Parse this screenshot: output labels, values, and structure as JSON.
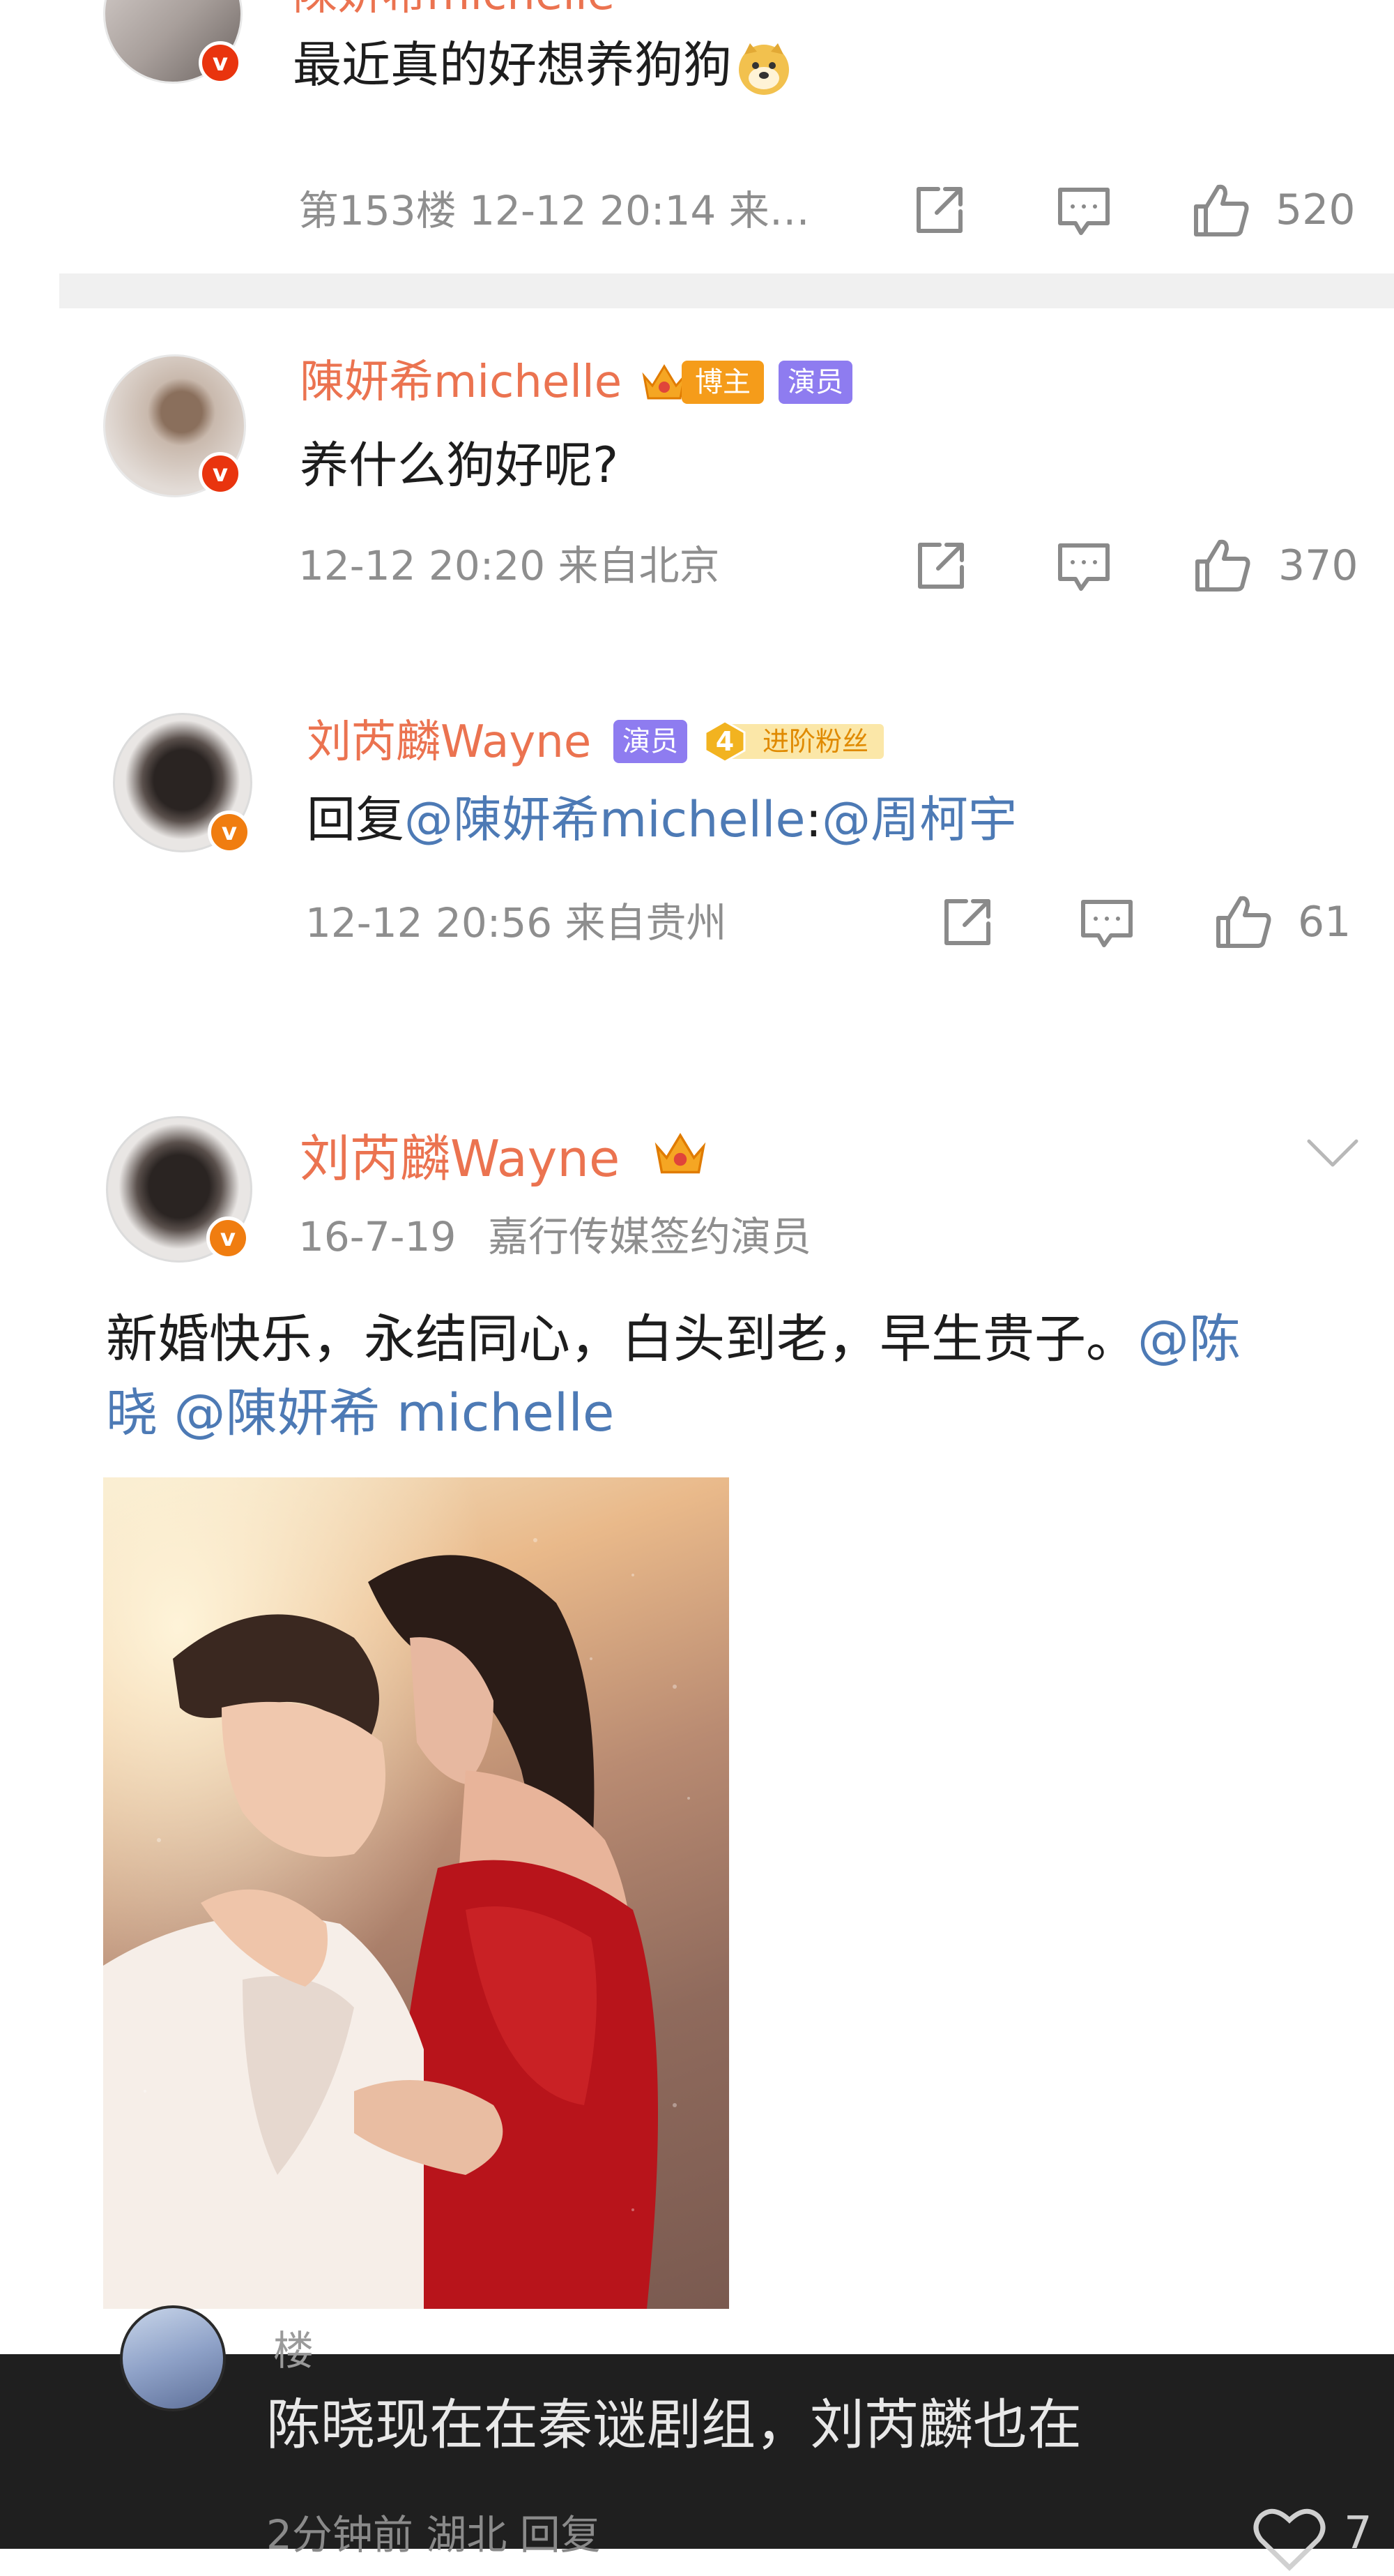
{
  "comments": [
    {
      "id": "c1",
      "text": "最近真的好想养狗狗",
      "emoji": "doge-emoji",
      "meta": "第153楼 12-12 20:14 来…",
      "likes": "520"
    },
    {
      "id": "c2",
      "username": "陳妍希michelle",
      "badges": [
        "博主",
        "演员"
      ],
      "text": "养什么狗好呢?",
      "meta": "12-12 20:20 来自北京",
      "likes": "370"
    },
    {
      "id": "c3",
      "username": "刘芮麟Wayne",
      "badges": [
        "演员",
        "进阶粉丝"
      ],
      "fan_level": "4",
      "reply_prefix": "回复",
      "reply_target": "@陳妍希michelle",
      "reply_sep": ":",
      "reply_mention": "@周柯宇",
      "meta": "12-12 20:56 来自贵州",
      "likes": "61"
    }
  ],
  "post": {
    "username": "刘芮麟Wayne",
    "date": "16-7-19",
    "source": "嘉行传媒签约演员",
    "text_line1": "新婚快乐，永结同心，白头到老，早生贵子。",
    "mention1_part1": "@陈",
    "mention1_part2": "晓",
    "mention2": "@陳妍希 michelle"
  },
  "overlay_comment": {
    "name_partial": "楼",
    "text": "陈晓现在在秦谜剧组，刘芮麟也在",
    "meta_partial": "2分钟前 湖北  回复",
    "likes_partial": "7"
  },
  "colors": {
    "username": "#eb7350",
    "link": "#4d7ab5",
    "meta": "#8e8e8e",
    "overlay_bg": "#1f1f1f"
  }
}
